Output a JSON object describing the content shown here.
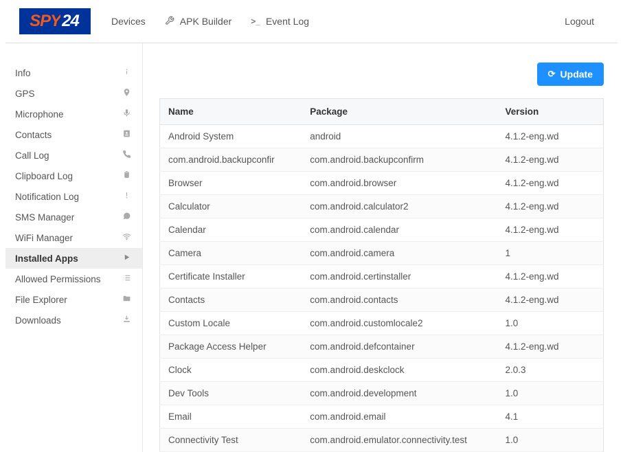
{
  "header": {
    "logo_text_1": "SPY",
    "logo_text_2": "24",
    "nav": [
      {
        "label": "Devices",
        "icon": ""
      },
      {
        "label": "APK Builder",
        "icon": "wrench"
      },
      {
        "label": "Event Log",
        "icon": "terminal"
      }
    ],
    "logout": "Logout"
  },
  "sidebar": {
    "items": [
      {
        "label": "Info",
        "icon": "info",
        "active": false
      },
      {
        "label": "GPS",
        "icon": "location",
        "active": false
      },
      {
        "label": "Microphone",
        "icon": "mic",
        "active": false
      },
      {
        "label": "Contacts",
        "icon": "contacts",
        "active": false
      },
      {
        "label": "Call Log",
        "icon": "phone",
        "active": false
      },
      {
        "label": "Clipboard Log",
        "icon": "clipboard",
        "active": false
      },
      {
        "label": "Notification Log",
        "icon": "exclaim",
        "active": false
      },
      {
        "label": "SMS Manager",
        "icon": "chat",
        "active": false
      },
      {
        "label": "WiFi Manager",
        "icon": "wifi",
        "active": false
      },
      {
        "label": "Installed Apps",
        "icon": "play",
        "active": true
      },
      {
        "label": "Allowed Permissions",
        "icon": "list",
        "active": false
      },
      {
        "label": "File Explorer",
        "icon": "folder",
        "active": false
      },
      {
        "label": "Downloads",
        "icon": "download",
        "active": false
      }
    ]
  },
  "toolbar": {
    "update_label": "Update"
  },
  "table": {
    "headers": {
      "name": "Name",
      "package": "Package",
      "version": "Version"
    },
    "rows": [
      {
        "name": "Android System",
        "package": "android",
        "version": "4.1.2-eng.wd"
      },
      {
        "name": "com.android.backupconfir",
        "package": "com.android.backupconfirm",
        "version": "4.1.2-eng.wd"
      },
      {
        "name": "Browser",
        "package": "com.android.browser",
        "version": "4.1.2-eng.wd"
      },
      {
        "name": "Calculator",
        "package": "com.android.calculator2",
        "version": "4.1.2-eng.wd"
      },
      {
        "name": "Calendar",
        "package": "com.android.calendar",
        "version": "4.1.2-eng.wd"
      },
      {
        "name": "Camera",
        "package": "com.android.camera",
        "version": "1"
      },
      {
        "name": "Certificate Installer",
        "package": "com.android.certinstaller",
        "version": "4.1.2-eng.wd"
      },
      {
        "name": "Contacts",
        "package": "com.android.contacts",
        "version": "4.1.2-eng.wd"
      },
      {
        "name": "Custom Locale",
        "package": "com.android.customlocale2",
        "version": "1.0"
      },
      {
        "name": "Package Access Helper",
        "package": "com.android.defcontainer",
        "version": "4.1.2-eng.wd"
      },
      {
        "name": "Clock",
        "package": "com.android.deskclock",
        "version": "2.0.3"
      },
      {
        "name": "Dev Tools",
        "package": "com.android.development",
        "version": "1.0"
      },
      {
        "name": "Email",
        "package": "com.android.email",
        "version": "4.1"
      },
      {
        "name": "Connectivity Test",
        "package": "com.android.emulator.connectivity.test",
        "version": "1.0"
      }
    ]
  },
  "icons": {
    "wrench": "🔧",
    "terminal": ">_",
    "info": "ℹ",
    "location": "📍",
    "mic": "🎤",
    "contacts": "👤",
    "phone": "✆",
    "clipboard": "📋",
    "exclaim": "!",
    "chat": "💬",
    "wifi": "≋",
    "play": "▶",
    "list": "☰",
    "folder": "📁",
    "download": "⬇",
    "refresh": "⟳"
  }
}
